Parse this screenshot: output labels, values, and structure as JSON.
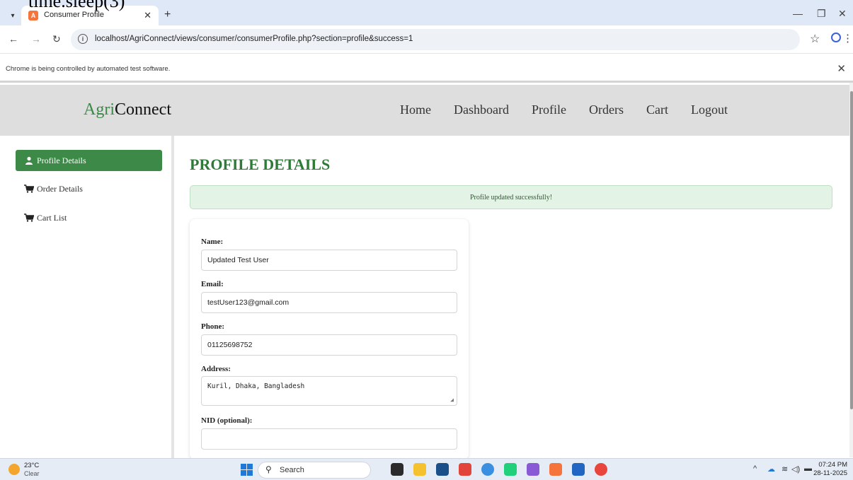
{
  "overlay": {
    "code_text": "time.sleep(3)"
  },
  "browser": {
    "tab": {
      "title": "Consumer Profile",
      "favicon_letter": "A"
    },
    "url": "localhost/AgriConnect/views/consumer/consumerProfile.php?section=profile&success=1",
    "infobar_text": "Chrome is being controlled by automated test software."
  },
  "site": {
    "logo_part1": "Agri",
    "logo_part2": "Connect",
    "nav": [
      "Home",
      "Dashboard",
      "Profile",
      "Orders",
      "Cart",
      "Logout"
    ]
  },
  "sidebar": {
    "items": [
      {
        "label": "Profile Details",
        "icon": "user-icon"
      },
      {
        "label": "Order Details",
        "icon": "cart-icon"
      },
      {
        "label": "Cart List",
        "icon": "cart-icon"
      }
    ]
  },
  "main": {
    "title": "PROFILE DETAILS",
    "alert": "Profile updated successfully!",
    "form": {
      "name_label": "Name:",
      "name_value": "Updated Test User",
      "email_label": "Email:",
      "email_value": "testUser123@gmail.com",
      "phone_label": "Phone:",
      "phone_value": "01125698752",
      "address_label": "Address:",
      "address_value": "Kuril, Dhaka, Bangladesh",
      "nid_label": "NID (optional):",
      "nid_value": ""
    }
  },
  "taskbar": {
    "temperature": "23°C",
    "condition": "Clear",
    "search_label": "Search",
    "time": "07:24 PM",
    "date": "28-11-2025"
  },
  "colors": {
    "brand_green": "#3d8a48",
    "title_green": "#2e7a38",
    "alert_bg": "#e3f3e6"
  }
}
